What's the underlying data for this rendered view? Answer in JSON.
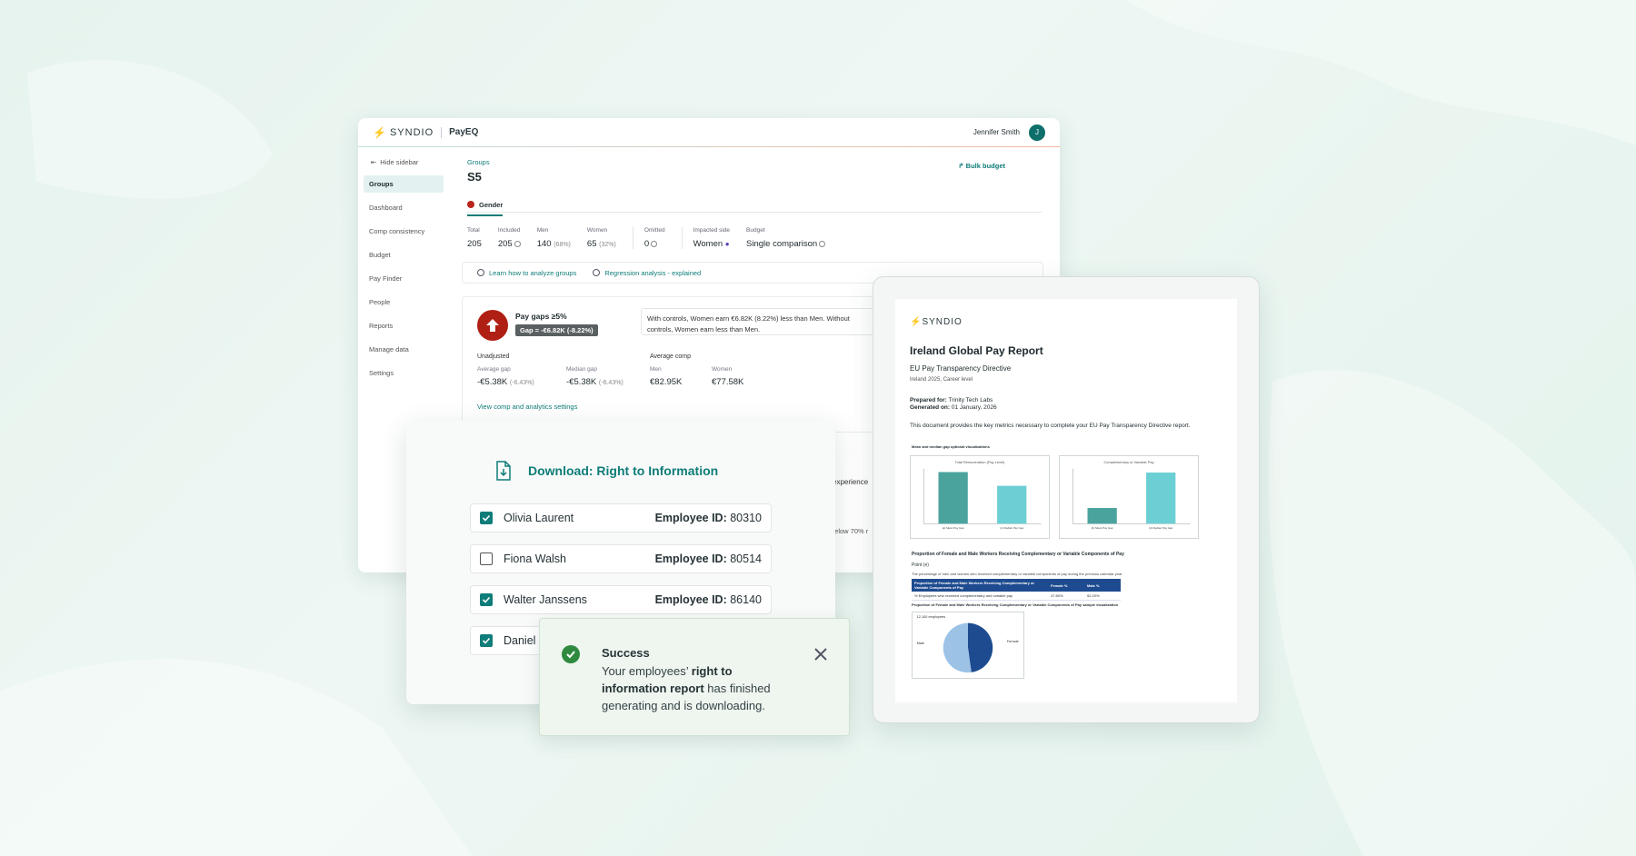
{
  "colors": {
    "brand": "#0e7c78",
    "danger": "#b01f14",
    "success": "#2f8a3f",
    "navy": "#1e4b8f",
    "teal_bar": "#4ba39e",
    "teal_bar_light": "#6ccfd3"
  },
  "app": {
    "logo": "SYNDIO",
    "product": "PayEQ",
    "user_name": "Jennifer Smith",
    "avatar_initial": "J",
    "hide_sidebar": "Hide sidebar",
    "sidebar": [
      "Groups",
      "Dashboard",
      "Comp consistency",
      "Budget",
      "Pay Finder",
      "People",
      "Reports",
      "Manage data",
      "Settings"
    ],
    "breadcrumb": "Groups",
    "page_title": "S5",
    "bulk_budget": "Bulk budget",
    "tab": "Gender",
    "stats": {
      "total_label": "Total",
      "total_value": "205",
      "included_label": "Included",
      "included_value": "205",
      "men_label": "Men",
      "men_value": "140",
      "men_pct": "(68%)",
      "women_label": "Women",
      "women_value": "65",
      "women_pct": "(32%)",
      "omitted_label": "Omitted",
      "omitted_value": "0",
      "impacted_label": "Impacted side",
      "impacted_value": "Women",
      "budget_label": "Budget",
      "budget_value": "Single comparison"
    },
    "links": {
      "learn": "Learn how to analyze groups",
      "regression": "Regression analysis - explained"
    },
    "gap": {
      "title": "Pay gaps ≥5%",
      "pill": "Gap = -€6.82K (-8.22%)",
      "note": "With controls, Women earn €6.82K (8.22%) less than Men. Without controls, Women earn less than Men.",
      "unadjusted": "Unadjusted",
      "avg_gap_label": "Average gap",
      "avg_gap_value": "-€5.38K",
      "avg_gap_pct": "(-6.43%)",
      "median_gap_label": "Median gap",
      "median_gap_value": "-€5.38K",
      "median_gap_pct": "(-6.43%)",
      "avg_comp": "Average comp",
      "men_label": "Men",
      "men_value": "€82.95K",
      "women_label": "Women",
      "women_value": "€77.58K",
      "view_link": "View comp and analytics settings"
    },
    "peek": {
      "experience": "experience",
      "below": "below 70% r"
    }
  },
  "dialog": {
    "title": "Download: Right to Information",
    "id_label": "Employee ID:",
    "employees": [
      {
        "name": "Olivia Laurent",
        "id": "80310",
        "checked": true
      },
      {
        "name": "Fiona Walsh",
        "id": "80514",
        "checked": false
      },
      {
        "name": "Walter Janssens",
        "id": "86140",
        "checked": true
      },
      {
        "name": "Daniel",
        "id": "",
        "checked": true
      }
    ]
  },
  "toast": {
    "title": "Success",
    "msg_pre": "Your employees’ ",
    "msg_bold": "right to information report",
    "msg_post": " has finished generating and is downloading."
  },
  "report": {
    "logo": "SYNDIO",
    "title": "Ireland Global Pay Report",
    "subtitle": "EU Pay Transparency Directive",
    "subtitle2": "Ireland 2025, Career level",
    "prepared_label": "Prepared for:",
    "prepared_value": "Trinity Tech Labs",
    "generated_label": "Generated on:",
    "generated_value": "01 January, 2026",
    "description": "This document provides the key metrics necessary to complete your EU Pay Transparency Directive report.",
    "section1": "Mean and median gap optional visualizations",
    "chart1_title": "Total Remuneration (Pay Level)",
    "chart2_title": "Complementary or Variable Pay",
    "section2": "Proportion of Female and Male Workers Receiving Complementary or Variable Components of Pay",
    "section2b": "Point (e)",
    "paragraph": "The percentage of men and women who received complementary or variable components of pay during the previous calendar year.",
    "table_head": [
      "Proportion of Female and Male Workers Receiving Complementary or Variable Components of Pay",
      "Female %",
      "Male %"
    ],
    "table_row": [
      "% Employees who received complementary and variable pay",
      "47.80%",
      "52.20%"
    ],
    "section3": "Proportion of Female and Male Workers Receiving Complementary or Variable Components of Pay sample visualization",
    "pie_caption": "12,100 employees",
    "pie_male": "Male",
    "pie_female": "Female"
  },
  "chart_data": [
    {
      "type": "bar",
      "title": "Total Remuneration (Pay Level)",
      "categories": [
        "(a) Mean Pay Gap",
        "(c) Median Pay Gap"
      ],
      "values": [
        0.15,
        0.11
      ]
    },
    {
      "type": "bar",
      "title": "Complementary or Variable Pay",
      "categories": [
        "(b) Mean Pay Gap",
        "(d) Median Pay Gap"
      ],
      "values": [
        0.8,
        2.6
      ]
    },
    {
      "type": "pie",
      "categories": [
        "Male",
        "Female"
      ],
      "values": [
        52.2,
        47.8
      ]
    }
  ]
}
